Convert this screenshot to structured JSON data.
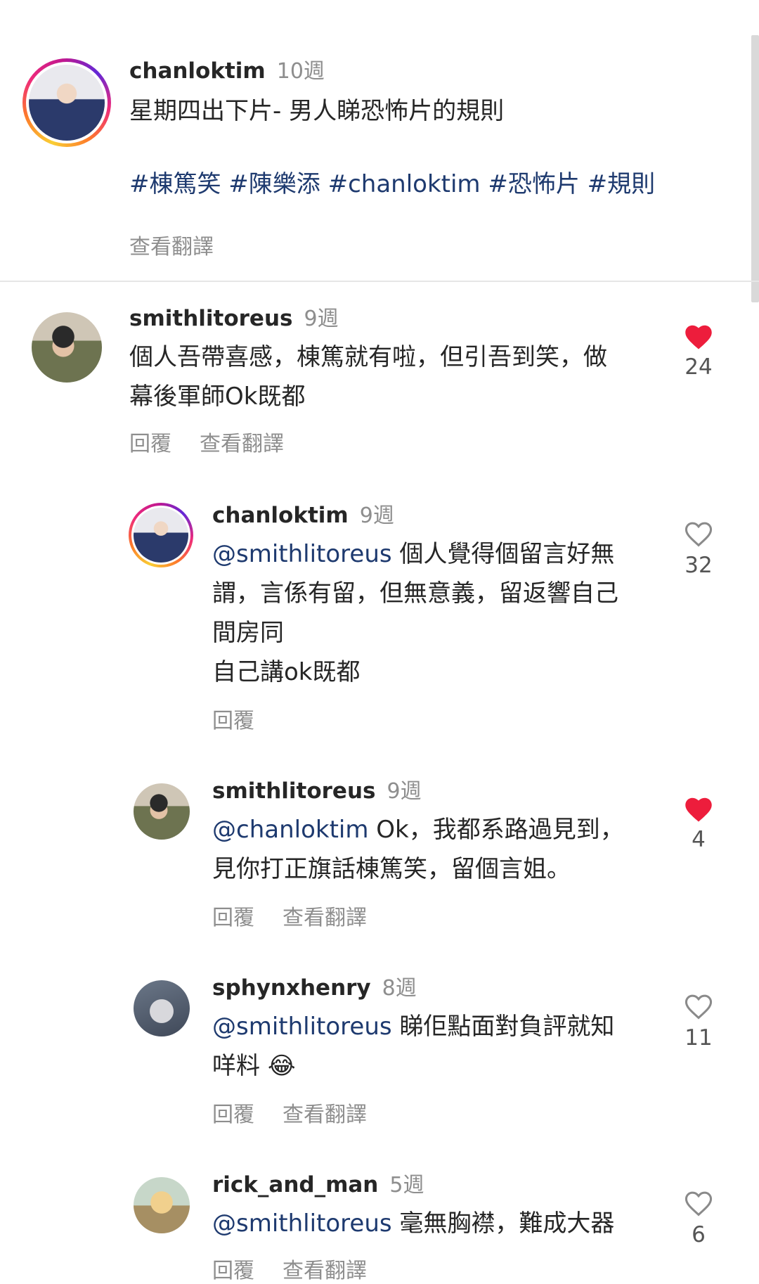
{
  "caption": {
    "username": "chanloktim",
    "time": "10週",
    "text": "星期四出下片- 男人睇恐怖片的規則",
    "hashtags": "#棟篤笑 #陳樂添 #chanloktim #恐怖片 #規則",
    "translate_label": "查看翻譯"
  },
  "comments": [
    {
      "username": "smithlitoreus",
      "time": "9週",
      "line1": "個人吾帶喜感，棟篤就有啦，但引吾到笑，做",
      "line2": "幕後軍師Ok既都",
      "reply_label": "回覆",
      "translate_label": "查看翻譯",
      "likes": "24",
      "liked": true
    },
    {
      "username": "chanloktim",
      "time": "9週",
      "mention": "@smithlitoreus",
      "line1": " 個人覺得個留言好無",
      "line2": "謂，言係有留，但無意義，留返響自己",
      "line3": "間房同",
      "line4": "自己講ok既都",
      "reply_label": "回覆",
      "likes": "32",
      "liked": false
    },
    {
      "username": "smithlitoreus",
      "time": "9週",
      "mention": "@chanloktim",
      "line1": " Ok，我都系路過見到，",
      "line2": "見你打正旗話棟篤笑，留個言姐。",
      "reply_label": "回覆",
      "translate_label": "查看翻譯",
      "likes": "4",
      "liked": true
    },
    {
      "username": "sphynxhenry",
      "time": "8週",
      "mention": "@smithlitoreus",
      "line1": " 睇佢點面對負評就知",
      "line2": "咩料",
      "emoji": "😂",
      "reply_label": "回覆",
      "translate_label": "查看翻譯",
      "likes": "11",
      "liked": false
    },
    {
      "username": "rick_and_man",
      "time": "5週",
      "mention": "@smithlitoreus",
      "line1": " 毫無胸襟，難成大器",
      "reply_label": "回覆",
      "translate_label": "查看翻譯",
      "likes": "6",
      "liked": false
    }
  ],
  "icons": {
    "heart_filled": "heart-filled-icon",
    "heart_outline": "heart-outline-icon"
  },
  "colors": {
    "like_red": "#ed1d3c",
    "link_blue": "#1e3a6f",
    "muted_gray": "#8e8e8e"
  }
}
